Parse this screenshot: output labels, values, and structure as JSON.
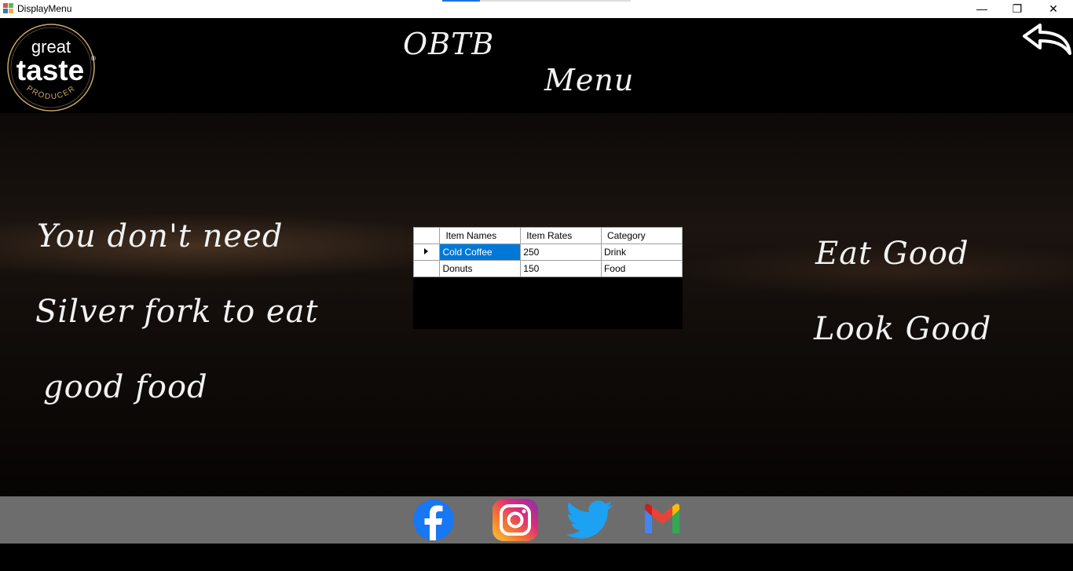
{
  "window": {
    "title": "DisplayMenu",
    "load_progress": 0.2,
    "minimize_symbol": "—",
    "restore_symbol": "❐",
    "close_symbol": "✕"
  },
  "header": {
    "logo": {
      "line1": "great",
      "line2": "taste",
      "line3": "PRODUCER",
      "mark": "®"
    },
    "brand": "OBTB",
    "subtitle": "Menu",
    "back_icon": "back-arrow-icon"
  },
  "left_slogan": [
    "You don't need",
    "Silver fork to eat",
    "good food"
  ],
  "right_slogan": [
    "Eat Good",
    "Look Good"
  ],
  "menu_grid": {
    "columns": [
      "Item Names",
      "Item Rates",
      "Category"
    ],
    "rows": [
      {
        "name": "Cold Coffee",
        "rate": "250",
        "category": "Drink",
        "current": true
      },
      {
        "name": "Donuts",
        "rate": "150",
        "category": "Food",
        "current": false
      }
    ]
  },
  "footer": {
    "icons": [
      "facebook-icon",
      "instagram-icon",
      "twitter-icon",
      "gmail-icon"
    ]
  },
  "colors": {
    "selection": "#0078d7",
    "footer_bg": "#6d6d6d",
    "facebook": "#1877f2",
    "twitter": "#1da1f2"
  }
}
